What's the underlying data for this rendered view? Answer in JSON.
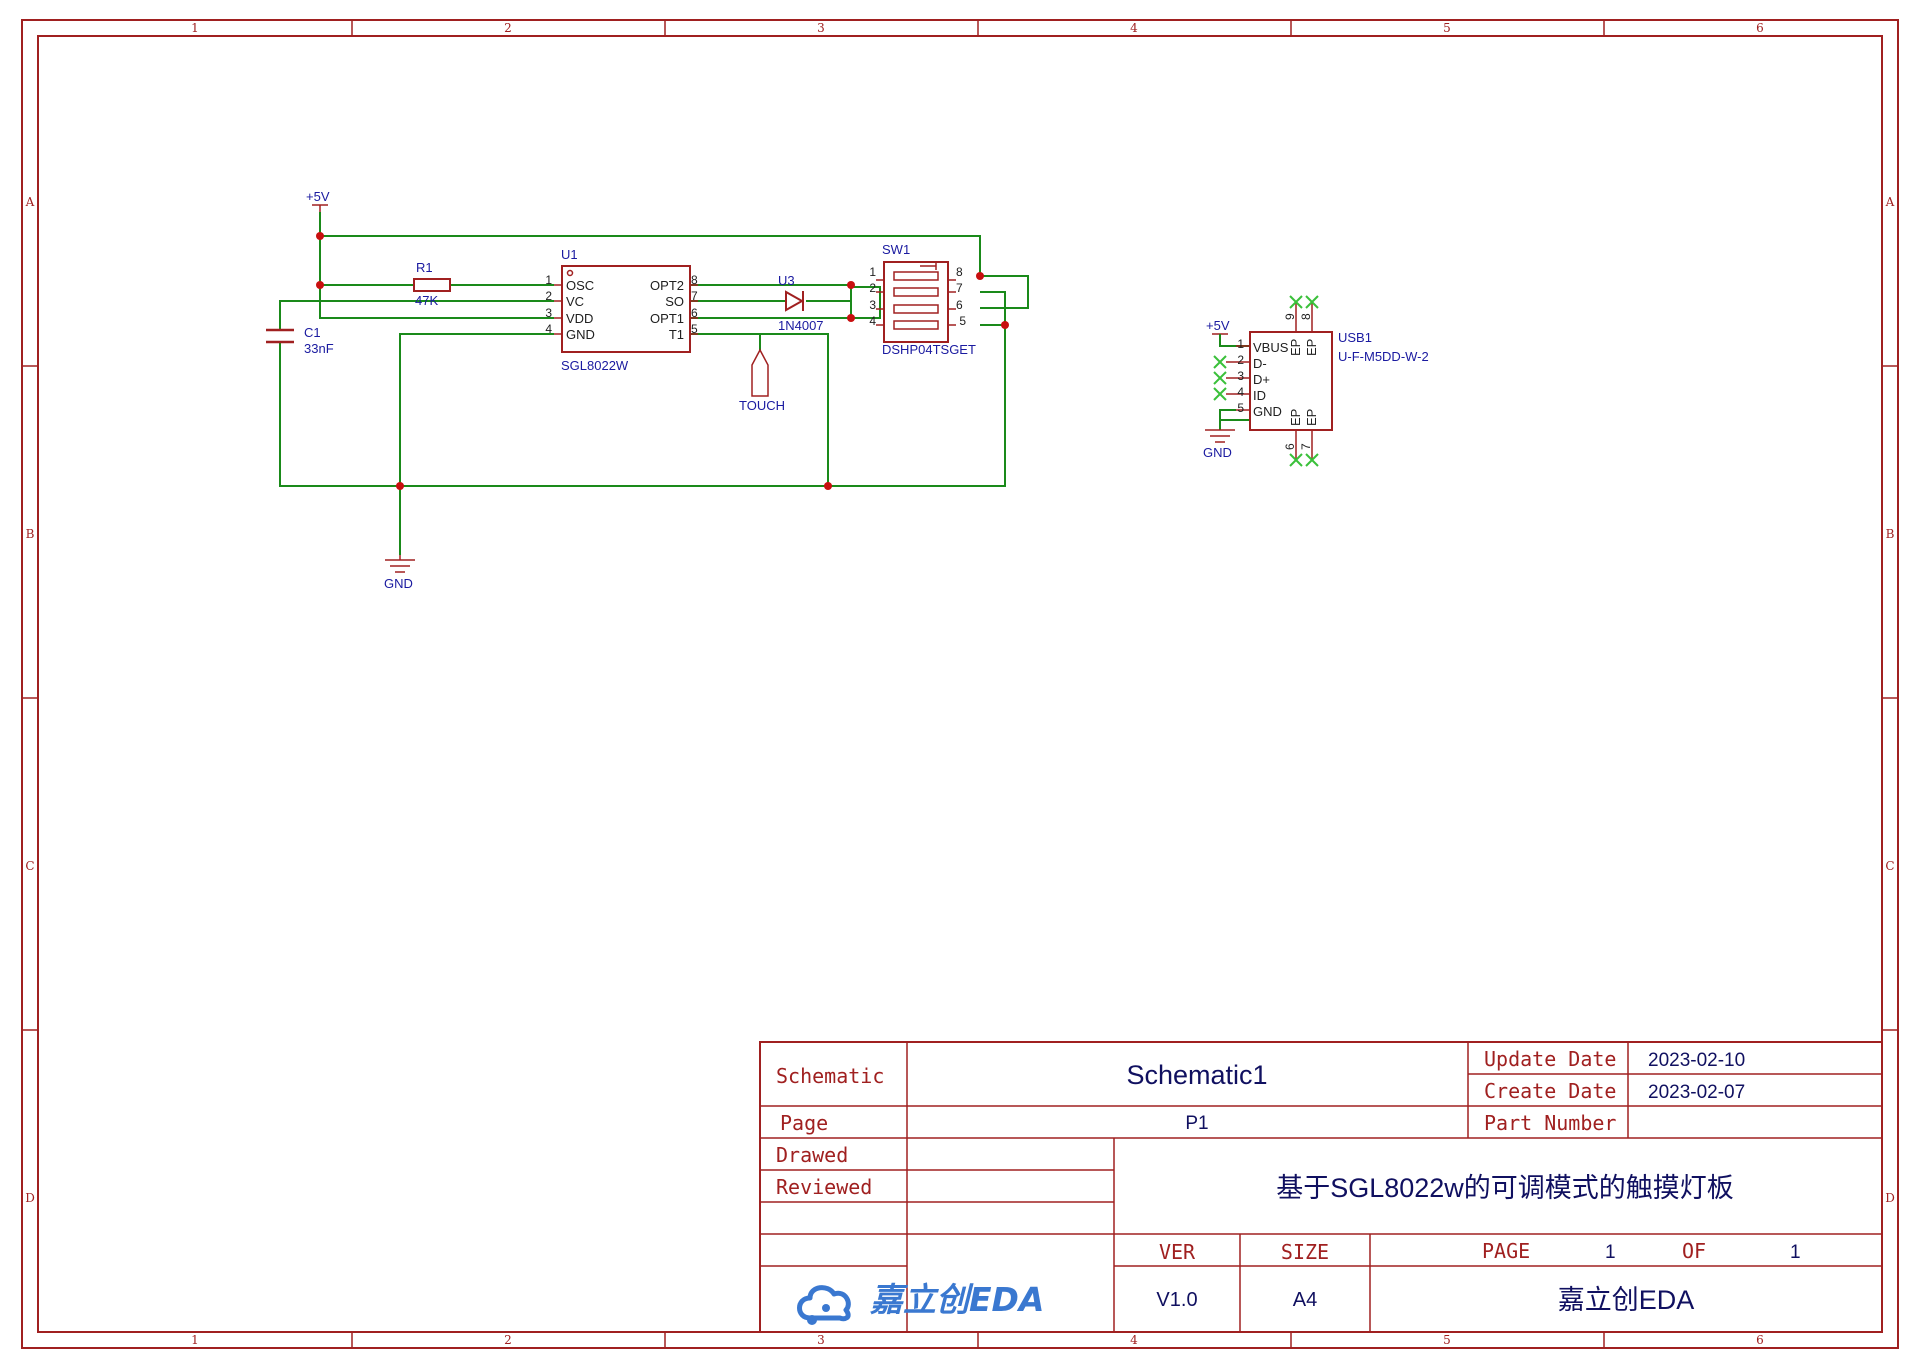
{
  "frame": {
    "col_labels": [
      "1",
      "2",
      "3",
      "4",
      "5",
      "6"
    ],
    "row_labels": [
      "A",
      "B",
      "C",
      "D"
    ]
  },
  "schematic": {
    "pwr_5v_a": "+5V",
    "pwr_5v_b": "+5V",
    "gnd_a": "GND",
    "gnd_b": "GND",
    "r1": {
      "ref": "R1",
      "value": "47K"
    },
    "c1": {
      "ref": "C1",
      "value": "33nF"
    },
    "u1": {
      "ref": "U1",
      "value": "SGL8022W",
      "left_pins": [
        {
          "num": "1",
          "name": "OSC"
        },
        {
          "num": "2",
          "name": "VC"
        },
        {
          "num": "3",
          "name": "VDD"
        },
        {
          "num": "4",
          "name": "GND"
        }
      ],
      "right_pins": [
        {
          "num": "8",
          "name": "OPT2"
        },
        {
          "num": "7",
          "name": "SO"
        },
        {
          "num": "6",
          "name": "OPT1"
        },
        {
          "num": "5",
          "name": "T1"
        }
      ]
    },
    "u3": {
      "ref": "U3",
      "value": "1N4007"
    },
    "touch": "TOUCH",
    "sw1": {
      "ref": "SW1",
      "value": "DSHP04TSGET",
      "left_nums": [
        "1",
        "2",
        "3",
        "4"
      ],
      "right_nums": [
        "8",
        "7",
        "6",
        "5"
      ]
    },
    "usb1": {
      "ref": "USB1",
      "value": "U-F-M5DD-W-2",
      "pins": [
        {
          "num": "1",
          "name": "VBUS"
        },
        {
          "num": "2",
          "name": "D-"
        },
        {
          "num": "3",
          "name": "D+"
        },
        {
          "num": "4",
          "name": "ID"
        },
        {
          "num": "5",
          "name": "GND"
        }
      ],
      "ep_top": [
        {
          "num": "9",
          "name": "EP"
        },
        {
          "num": "8",
          "name": "EP"
        }
      ],
      "ep_bottom": [
        {
          "num": "6",
          "name": "EP"
        },
        {
          "num": "7",
          "name": "EP"
        }
      ]
    }
  },
  "title_block": {
    "schematic_label": "Schematic",
    "schematic_value": "Schematic1",
    "page_label": "Page",
    "page_value": "P1",
    "drawed_label": "Drawed",
    "reviewed_label": "Reviewed",
    "update_date_label": "Update Date",
    "update_date": "2023-02-10",
    "create_date_label": "Create Date",
    "create_date": "2023-02-07",
    "part_number_label": "Part Number",
    "project_title": "基于SGL8022w的可调模式的触摸灯板",
    "ver_label": "VER",
    "ver_value": "V1.0",
    "size_label": "SIZE",
    "size_value": "A4",
    "page_no_label": "PAGE",
    "page_no": "1",
    "of_label": "OF",
    "page_total": "1",
    "logo_text": "嘉立创EDA",
    "company": "嘉立创EDA"
  },
  "colors": {
    "frame": "#a02020",
    "wire": "#1a8a1a",
    "text": "#1a1aa0",
    "junction": "#c81010",
    "logo": "#3a78d0"
  }
}
